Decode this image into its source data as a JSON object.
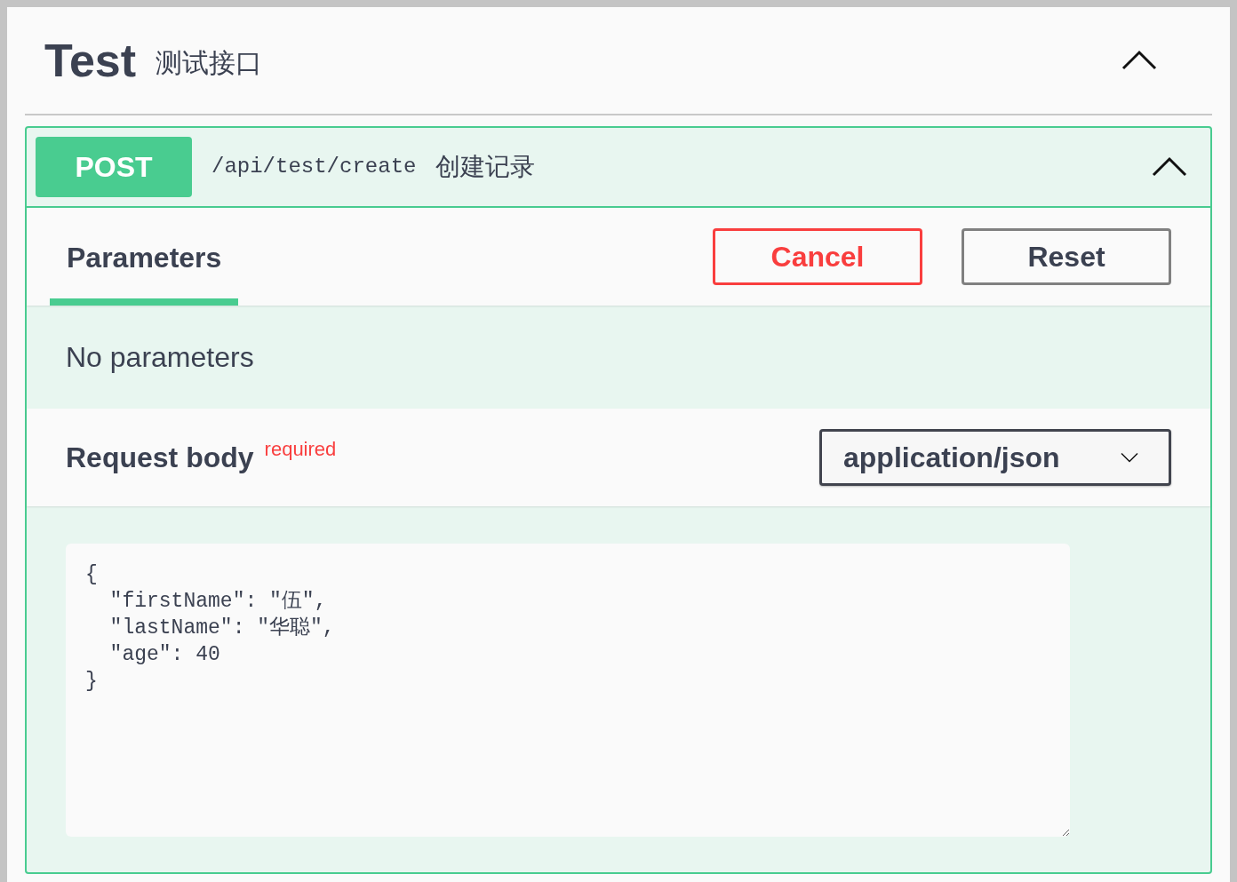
{
  "tag": {
    "name": "Test",
    "description": "测试接口",
    "expanded": true
  },
  "operation": {
    "method": "POST",
    "path": "/api/test/create",
    "summary": "创建记录",
    "expanded": true
  },
  "tabs": [
    {
      "label": "Parameters",
      "selected": true
    }
  ],
  "buttons": [
    {
      "label": "Cancel",
      "kind": "cancel"
    },
    {
      "label": "Reset",
      "kind": "reset"
    }
  ],
  "parameters": {
    "message": "No parameters"
  },
  "request_body": {
    "title": "Request body",
    "required_label": "required",
    "content_type": "application/json",
    "value": "{\n  \"firstName\": \"伍\",\n  \"lastName\": \"华聪\",\n  \"age\": 40\n}"
  }
}
